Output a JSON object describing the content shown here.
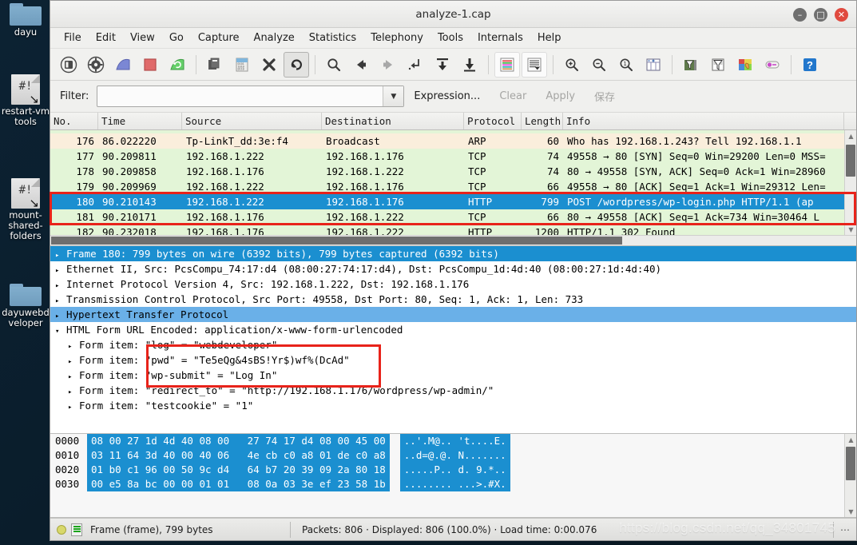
{
  "desktop": {
    "icons": [
      {
        "name": "dayu",
        "label": "dayu",
        "type": "folder"
      },
      {
        "name": "restart-vmtools",
        "label": "restart-vm\ntools",
        "type": "script"
      },
      {
        "name": "mount-shared-folders",
        "label": "mount-\nshared-\nfolders",
        "type": "script"
      },
      {
        "name": "dayuwebdeveloper",
        "label": "dayuwebd\nveloper",
        "type": "folder"
      }
    ]
  },
  "window": {
    "title": "analyze-1.cap",
    "buttons": {
      "minimize": "–",
      "maximize": "□",
      "close": "✕"
    }
  },
  "menu": {
    "items": [
      "File",
      "Edit",
      "View",
      "Go",
      "Capture",
      "Analyze",
      "Statistics",
      "Telephony",
      "Tools",
      "Internals",
      "Help"
    ]
  },
  "toolbar": {
    "buttons": [
      {
        "name": "interfaces-icon",
        "title": "Interfaces"
      },
      {
        "name": "capture-options-icon",
        "title": "Capture Options"
      },
      {
        "name": "start-capture-icon",
        "title": "Start"
      },
      {
        "name": "stop-capture-icon",
        "title": "Stop"
      },
      {
        "name": "restart-capture-icon",
        "title": "Restart"
      },
      {
        "name": "open-file-icon",
        "title": "Open"
      },
      {
        "name": "save-file-icon",
        "title": "Save"
      },
      {
        "name": "close-file-icon",
        "title": "Close"
      },
      {
        "name": "reload-icon",
        "title": "Reload"
      },
      {
        "name": "find-packet-icon",
        "title": "Find Packet"
      },
      {
        "name": "go-back-icon",
        "title": "Go Back"
      },
      {
        "name": "go-forward-icon",
        "title": "Go Forward"
      },
      {
        "name": "go-to-packet-icon",
        "title": "Go To Packet"
      },
      {
        "name": "go-to-first-icon",
        "title": "Go To First Packet"
      },
      {
        "name": "go-to-last-icon",
        "title": "Go To Last Packet"
      },
      {
        "name": "colorize-icon",
        "title": "Colorize"
      },
      {
        "name": "autoscroll-icon",
        "title": "Auto Scroll"
      },
      {
        "name": "zoom-in-icon",
        "title": "Zoom In"
      },
      {
        "name": "zoom-out-icon",
        "title": "Zoom Out"
      },
      {
        "name": "zoom-reset-icon",
        "title": "Normal Size"
      },
      {
        "name": "resize-columns-icon",
        "title": "Resize Columns"
      },
      {
        "name": "capture-filters-icon",
        "title": "Capture Filters"
      },
      {
        "name": "display-filters-icon",
        "title": "Display Filters"
      },
      {
        "name": "coloring-rules-icon",
        "title": "Coloring Rules"
      },
      {
        "name": "preferences-icon",
        "title": "Preferences"
      },
      {
        "name": "help-icon",
        "title": "Help"
      }
    ]
  },
  "filterbar": {
    "label": "Filter:",
    "value": "",
    "placeholder": "",
    "dropdown_glyph": "▼",
    "expression_label": "Expression...",
    "clear_label": "Clear",
    "apply_label": "Apply",
    "save_label": "保存"
  },
  "packet_list": {
    "columns": [
      "No.",
      "Time",
      "Source",
      "Destination",
      "Protocol",
      "Length",
      "Info"
    ],
    "rows": [
      {
        "no": "176",
        "time": "86.022220",
        "source": "Tp-LinkT_dd:3e:f4",
        "destination": "Broadcast",
        "protocol": "ARP",
        "length": "60",
        "info": "Who has 192.168.1.243? Tell 192.168.1.1",
        "style": "arp"
      },
      {
        "no": "177",
        "time": "90.209811",
        "source": "192.168.1.222",
        "destination": "192.168.1.176",
        "protocol": "TCP",
        "length": "74",
        "info": "49558 → 80 [SYN] Seq=0 Win=29200 Len=0 MSS=",
        "style": "tcp"
      },
      {
        "no": "178",
        "time": "90.209858",
        "source": "192.168.1.176",
        "destination": "192.168.1.222",
        "protocol": "TCP",
        "length": "74",
        "info": "80 → 49558 [SYN, ACK] Seq=0 Ack=1 Win=28960",
        "style": "tcp"
      },
      {
        "no": "179",
        "time": "90.209969",
        "source": "192.168.1.222",
        "destination": "192.168.1.176",
        "protocol": "TCP",
        "length": "66",
        "info": "49558 → 80 [ACK] Seq=1 Ack=1 Win=29312 Len=",
        "style": "tcp"
      },
      {
        "no": "180",
        "time": "90.210143",
        "source": "192.168.1.222",
        "destination": "192.168.1.176",
        "protocol": "HTTP",
        "length": "799",
        "info": "POST /wordpress/wp-login.php HTTP/1.1  (ap",
        "style": "sel"
      },
      {
        "no": "181",
        "time": "90.210171",
        "source": "192.168.1.176",
        "destination": "192.168.1.222",
        "protocol": "TCP",
        "length": "66",
        "info": "80 → 49558 [ACK] Seq=1 Ack=734 Win=30464 L",
        "style": "tcp"
      },
      {
        "no": "182",
        "time": "90.232018",
        "source": "192.168.1.176",
        "destination": "192.168.1.222",
        "protocol": "HTTP",
        "length": "1200",
        "info": "HTTP/1.1 302 Found",
        "style": "http"
      }
    ]
  },
  "packet_detail": {
    "rows": [
      {
        "text": "Frame 180: 799 bytes on wire (6392 bits), 799 bytes captured (6392 bits)",
        "triangle": "▸",
        "style": "sel-dark",
        "indent": false
      },
      {
        "text": "Ethernet II, Src: PcsCompu_74:17:d4 (08:00:27:74:17:d4), Dst: PcsCompu_1d:4d:40 (08:00:27:1d:4d:40)",
        "triangle": "▸",
        "style": "",
        "indent": false
      },
      {
        "text": "Internet Protocol Version 4, Src: 192.168.1.222, Dst: 192.168.1.176",
        "triangle": "▸",
        "style": "",
        "indent": false
      },
      {
        "text": "Transmission Control Protocol, Src Port: 49558, Dst Port: 80, Seq: 1, Ack: 1, Len: 733",
        "triangle": "▸",
        "style": "",
        "indent": false
      },
      {
        "text": "Hypertext Transfer Protocol",
        "triangle": "▸",
        "style": "sel-light",
        "indent": false
      },
      {
        "text": "HTML Form URL Encoded: application/x-www-form-urlencoded",
        "triangle": "▾",
        "style": "",
        "indent": false
      },
      {
        "text": "Form item: \"log\" = \"webdeveloper\"",
        "triangle": "▸",
        "style": "",
        "indent": true
      },
      {
        "text": "Form item: \"pwd\" = \"Te5eQg&4sBS!Yr$)wf%(DcAd\"",
        "triangle": "▸",
        "style": "",
        "indent": true
      },
      {
        "text": "Form item: \"wp-submit\" = \"Log In\"",
        "triangle": "▸",
        "style": "",
        "indent": true
      },
      {
        "text": "Form item: \"redirect_to\" = \"http://192.168.1.176/wordpress/wp-admin/\"",
        "triangle": "▸",
        "style": "",
        "indent": true
      },
      {
        "text": "Form item: \"testcookie\" = \"1\"",
        "triangle": "▸",
        "style": "",
        "indent": true
      }
    ]
  },
  "hex_pane": {
    "rows": [
      {
        "offset": "0000",
        "bytes": "08 00 27 1d 4d 40 08 00   27 74 17 d4 08 00 45 00",
        "ascii": "..'.M@.. 't....E."
      },
      {
        "offset": "0010",
        "bytes": "03 11 64 3d 40 00 40 06   4e cb c0 a8 01 de c0 a8",
        "ascii": "..d=@.@. N......."
      },
      {
        "offset": "0020",
        "bytes": "01 b0 c1 96 00 50 9c d4   64 b7 20 39 09 2a 80 18",
        "ascii": ".....P.. d. 9.*.."
      },
      {
        "offset": "0030",
        "bytes": "00 e5 8a bc 00 00 01 01   08 0a 03 3e ef 23 58 1b",
        "ascii": "........ ...>.#X."
      }
    ]
  },
  "statusbar": {
    "left": "Frame (frame), 799 bytes",
    "middle": "Packets: 806 · Displayed: 806 (100.0%) · Load time: 0:00.076",
    "right": "⋯",
    "watermark": "https://blog.csdn.net/qq_34801745"
  },
  "colors": {
    "selection_blue": "#1b8fd0",
    "selection_light_blue": "#6ab0e8",
    "tcp_green": "#e3f5d7",
    "arp_beige": "#faeedc",
    "annotation_red": "#e8231a"
  }
}
